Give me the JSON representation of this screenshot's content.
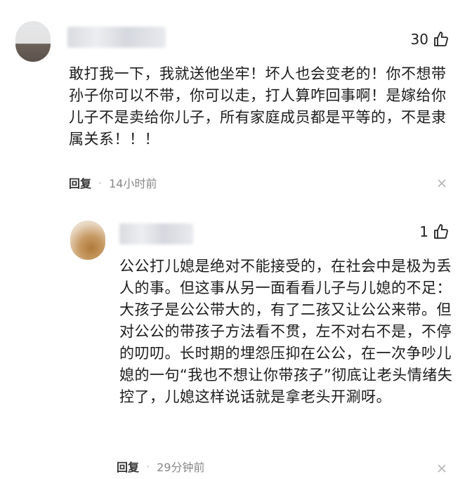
{
  "comments": [
    {
      "likes": "30",
      "text": "敢打我一下，我就送他坐牢！坏人也会变老的！你不想带孙子你可以不带，你可以走，打人算咋回事啊！是嫁给你儿子不是卖给你儿子，所有家庭成员都是平等的，不是隶属关系！！！",
      "reply_label": "回复",
      "separator": "·",
      "time": "14小时前"
    },
    {
      "likes": "1",
      "text": "公公打儿媳是绝对不能接受的，在社会中是极为丢人的事。但这事从另一面看看儿子与儿媳的不足： 大孩子是公公带大的，有了二孩又让公公来带。但对公公的带孩子方法看不贯，左不对右不是，不停的叨叨。长时期的埋怨压抑在公公，在一次争吵儿媳的一句“我也不想让你带孩子”彻底让老头情绪失控了，儿媳这样说话就是拿老头开涮呀。",
      "reply_label": "回复",
      "separator": "·",
      "time": "29分钟前"
    }
  ]
}
